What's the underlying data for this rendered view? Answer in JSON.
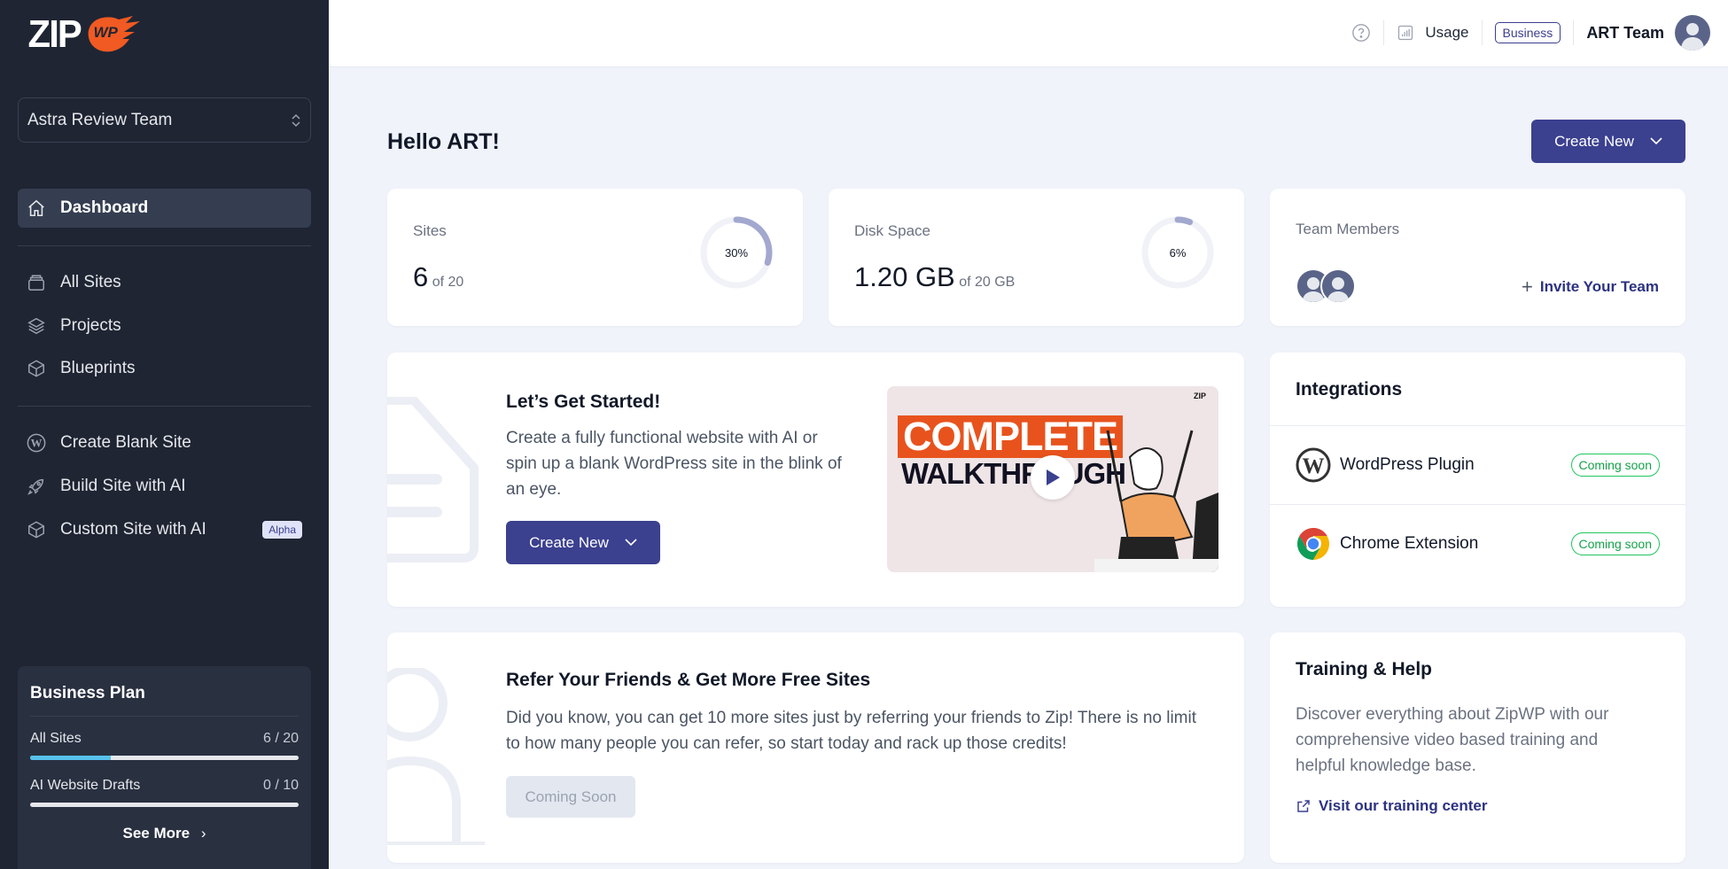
{
  "brand": {
    "logo_text": "ZIP",
    "logo_badge": "WP",
    "accent": "#3b408f",
    "logo_orange": "#f15a22"
  },
  "sidebar": {
    "team_selector": "Astra Review Team",
    "items": [
      {
        "label": "Dashboard",
        "icon": "home-icon",
        "active": true
      },
      {
        "label": "All Sites",
        "icon": "sites-stack-icon"
      },
      {
        "label": "Projects",
        "icon": "layers-icon"
      },
      {
        "label": "Blueprints",
        "icon": "cube-icon"
      },
      {
        "label": "Create Blank Site",
        "icon": "wordpress-icon"
      },
      {
        "label": "Build Site with AI",
        "icon": "rocket-icon"
      },
      {
        "label": "Custom Site with AI",
        "icon": "cube-icon",
        "badge": "Alpha"
      }
    ],
    "plan": {
      "title": "Business Plan",
      "rows": [
        {
          "label": "All Sites",
          "value": "6 / 20",
          "progress": 0.3
        },
        {
          "label": "AI Website Drafts",
          "value": "0 / 10",
          "progress": 0
        }
      ],
      "see_more": "See More"
    }
  },
  "topbar": {
    "help_icon": "help-circle-icon",
    "usage_label": "Usage",
    "plan_badge": "Business",
    "team_name": "ART Team"
  },
  "main": {
    "greeting": "Hello ART!",
    "create_new": "Create New",
    "stats": {
      "sites": {
        "label": "Sites",
        "value": "6",
        "of": "of 20",
        "percent_label": "30%",
        "percent": 30
      },
      "disk": {
        "label": "Disk Space",
        "value": "1.20 GB",
        "of": "of 20 GB",
        "percent_label": "6%",
        "percent": 6
      },
      "team": {
        "label": "Team Members",
        "member_count": 2,
        "invite": "Invite Your Team"
      }
    },
    "get_started": {
      "title": "Let’s Get Started!",
      "body": "Create a fully functional website with AI or spin up a blank WordPress site in the blink of an eye.",
      "button": "Create New",
      "video": {
        "line1": "COMPLETE",
        "line2": "WALKTHROUGH",
        "corner_logo": "ZIP"
      }
    },
    "integrations": {
      "title": "Integrations",
      "items": [
        {
          "name": "WordPress Plugin",
          "status": "Coming soon",
          "icon": "wordpress-icon"
        },
        {
          "name": "Chrome Extension",
          "status": "Coming soon",
          "icon": "chrome-icon"
        }
      ]
    },
    "refer": {
      "title": "Refer Your Friends & Get More Free Sites",
      "body": "Did you know, you can get 10 more sites just by referring your friends to Zip! There is no limit to how many people you can refer, so start today and rack up those credits!",
      "button": "Coming Soon"
    },
    "training": {
      "title": "Training & Help",
      "body": "Discover everything about ZipWP with our comprehensive video based training and helpful knowledge base.",
      "link": "Visit our training center"
    }
  }
}
